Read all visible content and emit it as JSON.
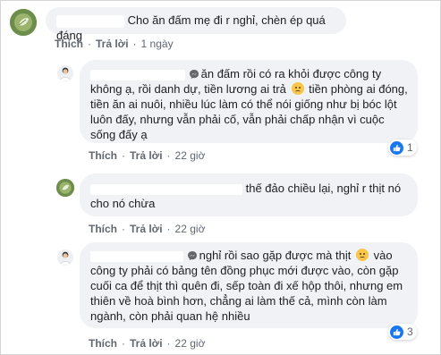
{
  "comments": [
    {
      "text_lines": [
        "Cho ăn đấm mẹ đi r nghỉ, chèn ép quá đáng"
      ],
      "actions": {
        "like": "Thích",
        "reply": "Trả lời",
        "time": "1 ngày"
      }
    },
    {
      "text_lines": [
        "ăn đấm rồi có ra khỏi được công ty",
        "không ạ, rồi danh dự, tiền lương ai trả",
        "tiền phòng ai đóng,",
        "tiền ăn ai nuôi, nhiều lúc làm có thể nói giống như bị bóc lột",
        "luôn đấy, nhưng vẫn phải cố, vẫn phải chấp nhận vì cuộc",
        "sống đấy ạ"
      ],
      "actions": {
        "like": "Thích",
        "reply": "Trả lời",
        "time": "22 giờ"
      },
      "reaction_count": "1"
    },
    {
      "text_lines": [
        "thế đảo chiều lại, nghỉ r thịt nó",
        "cho nó chừa"
      ],
      "actions": {
        "like": "Thích",
        "reply": "Trả lời",
        "time": "22 giờ"
      }
    },
    {
      "text_lines": [
        "nghỉ rồi sao gặp được mà thịt",
        "vào",
        "công ty phải có bảng tên đồng phục mới được vào, còn gặp",
        "cuối ca để thịt thì quên đi, sếp toàn đi xế hộp thôi, nhưng em",
        "thiên về hoà bình hơn, chẳng ai làm thế cả, mình còn làm",
        "ngành, còn phải quan hệ nhiều"
      ],
      "actions": {
        "like": "Thích",
        "reply": "Trả lời",
        "time": "22 giờ"
      },
      "reaction_count": "3"
    }
  ],
  "icons": {
    "avatar_leaf": "leaf-avatar-icon",
    "avatar_person": "person-avatar-icon",
    "messenger": "messenger-icon",
    "emoji": "disappointed-face-icon",
    "like": "like-icon"
  },
  "colors": {
    "bubble": "#f0f2f5",
    "like": "#1877f2",
    "meta": "#606770"
  }
}
